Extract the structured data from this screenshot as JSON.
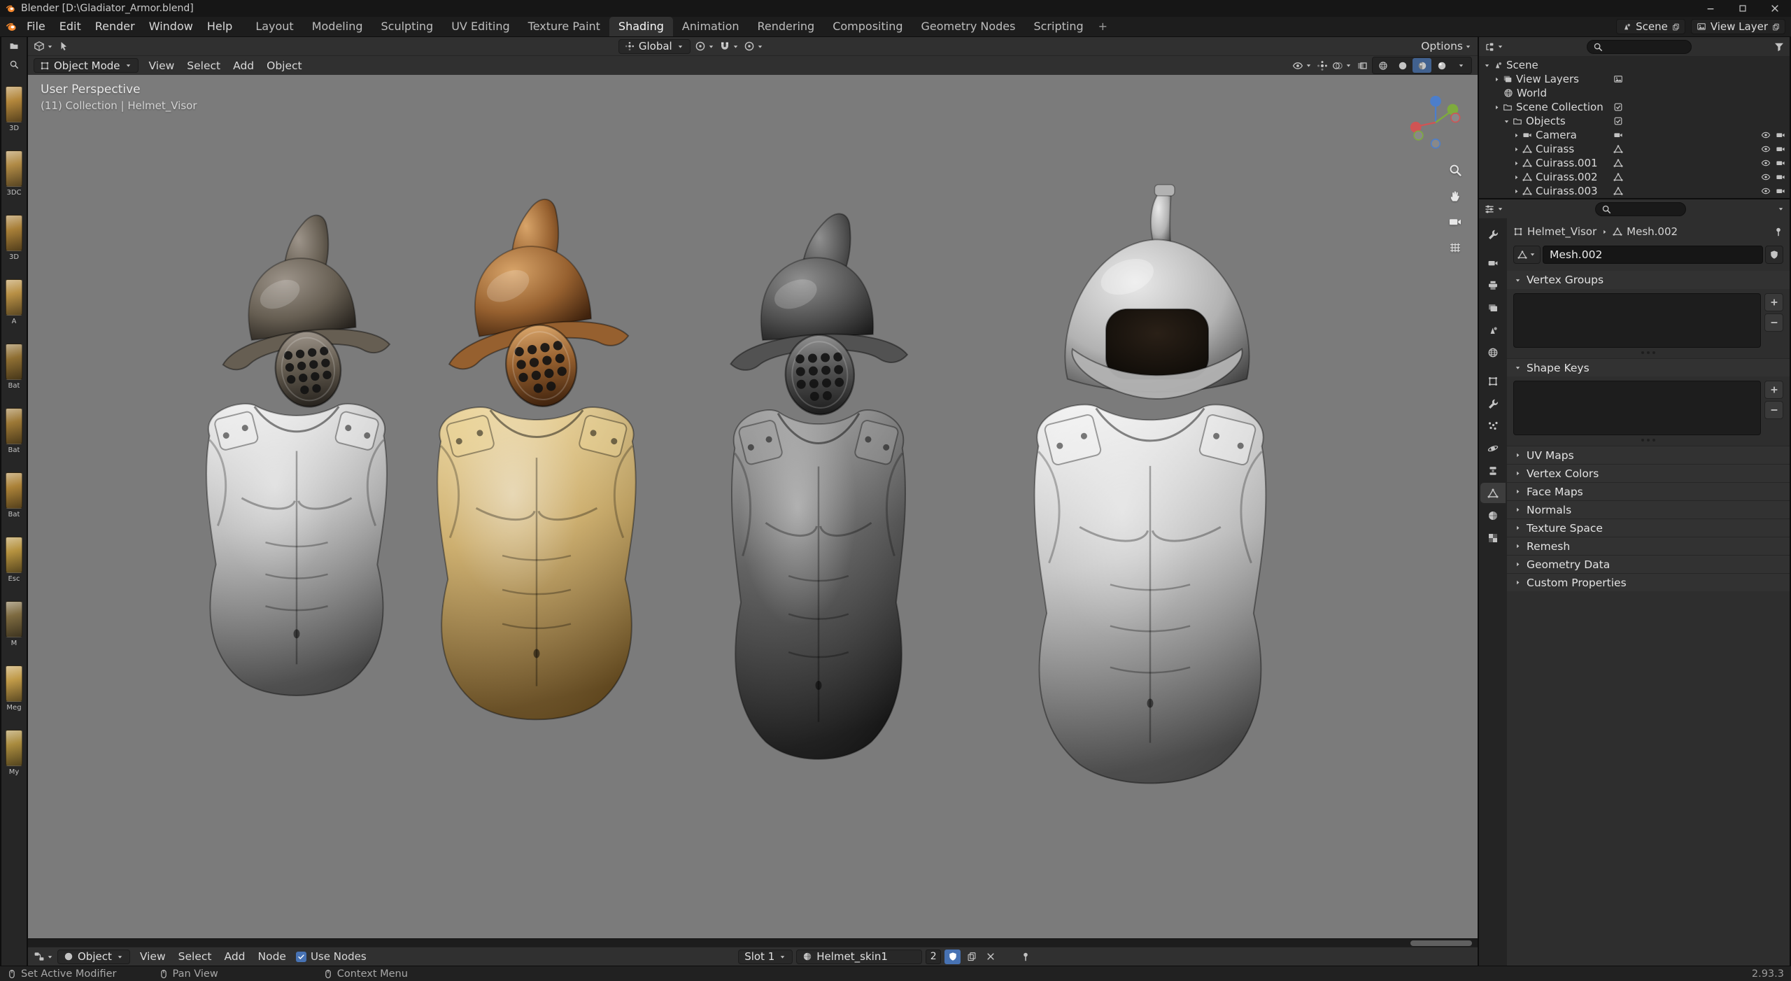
{
  "window": {
    "title": "Blender [D:\\Gladiator_Armor.blend]"
  },
  "topbar": {
    "menus": [
      "File",
      "Edit",
      "Render",
      "Window",
      "Help"
    ],
    "workspace_tabs": [
      "Layout",
      "Modeling",
      "Sculpting",
      "UV Editing",
      "Texture Paint",
      "Shading",
      "Animation",
      "Rendering",
      "Compositing",
      "Geometry Nodes",
      "Scripting"
    ],
    "active_tab": "Shading",
    "new_workspace_label": "+",
    "scene_selector": {
      "label": "Scene"
    },
    "view_layer_selector": {
      "label": "View Layer"
    }
  },
  "asset_strip": {
    "items": [
      {
        "label": "3D",
        "color": "#b3873c"
      },
      {
        "label": "3DC",
        "color": "#b08a45"
      },
      {
        "label": "3D",
        "color": "#a87f38"
      },
      {
        "label": "A",
        "color": "#b89045"
      },
      {
        "label": "Bat",
        "color": "#8f6f33"
      },
      {
        "label": "Bat",
        "color": "#9c7836"
      },
      {
        "label": "Bat",
        "color": "#ab8238"
      },
      {
        "label": "Esc",
        "color": "#b5923f"
      },
      {
        "label": "M",
        "color": "#7d6a40"
      },
      {
        "label": "Meg",
        "color": "#c09a48"
      },
      {
        "label": "My",
        "color": "#a98b3e"
      }
    ]
  },
  "viewport": {
    "tool_row": {
      "orientation": "Global",
      "options_label": "Options"
    },
    "header": {
      "mode": "Object Mode",
      "menus": [
        "View",
        "Select",
        "Add",
        "Object"
      ]
    },
    "overlay": {
      "line1": "User Perspective",
      "line2": "(11) Collection | Helmet_Visor"
    },
    "background_color": "#7b7b7b",
    "armor_sets": [
      {
        "name": "silver",
        "style": "closed",
        "torso": {
          "lite": "#f0f0f0",
          "base": "#b6b6b6",
          "dark": "#4f4f4f"
        },
        "helmet": {
          "lite": "#9d948a",
          "base": "#665e52",
          "dark": "#26221d"
        }
      },
      {
        "name": "bronze",
        "style": "closed",
        "torso": {
          "lite": "#ecd498",
          "base": "#c6a45c",
          "dark": "#6e501f"
        },
        "helmet": {
          "lite": "#d8a469",
          "base": "#96602f",
          "dark": "#3f220d"
        }
      },
      {
        "name": "dark-steel",
        "style": "closed",
        "torso": {
          "lite": "#9d9d9d",
          "base": "#4e4e4e",
          "dark": "#161616"
        },
        "helmet": {
          "lite": "#8f8f8f",
          "base": "#525252",
          "dark": "#1c1c1c"
        }
      },
      {
        "name": "polished-steel",
        "style": "open",
        "torso": {
          "lite": "#f4f4f4",
          "base": "#bfbfbf",
          "dark": "#4c4c4c"
        },
        "helmet": {
          "lite": "#e9e9e9",
          "base": "#b2b2b2",
          "dark": "#383838"
        }
      }
    ]
  },
  "outliner": {
    "rows": [
      {
        "label": "Scene",
        "depth": 0,
        "disclosure": "open",
        "icon": "scene"
      },
      {
        "label": "View Layers",
        "depth": 1,
        "disclosure": "closed",
        "icon": "layers",
        "data_icon": "photo"
      },
      {
        "label": "World",
        "depth": 1,
        "disclosure": "none",
        "icon": "globe"
      },
      {
        "label": "Scene Collection",
        "depth": 1,
        "disclosure": "closed",
        "icon": "collection",
        "data_icon": "check"
      },
      {
        "label": "Objects",
        "depth": 2,
        "disclosure": "open",
        "icon": "collection",
        "data_icon": "check"
      },
      {
        "label": "Camera",
        "depth": 3,
        "disclosure": "closed",
        "icon": "cam",
        "data_icon": "cam",
        "data_color": "green",
        "toggles": true
      },
      {
        "label": "Cuirass",
        "depth": 3,
        "disclosure": "closed",
        "icon": "tri",
        "data_icon": "tri",
        "data_color": "green",
        "toggles": true
      },
      {
        "label": "Cuirass.001",
        "depth": 3,
        "disclosure": "closed",
        "icon": "tri",
        "data_icon": "tri",
        "data_color": "green",
        "toggles": true
      },
      {
        "label": "Cuirass.002",
        "depth": 3,
        "disclosure": "closed",
        "icon": "tri",
        "data_icon": "tri",
        "data_color": "green",
        "toggles": true
      },
      {
        "label": "Cuirass.003",
        "depth": 3,
        "disclosure": "closed",
        "icon": "tri",
        "data_icon": "tri",
        "data_color": "green",
        "toggles": true
      }
    ]
  },
  "properties": {
    "breadcrumb": {
      "object": "Helmet_Visor",
      "data": "Mesh.002"
    },
    "datablock_name": "Mesh.002",
    "panels": [
      {
        "label": "Vertex Groups",
        "open": true
      },
      {
        "label": "Shape Keys",
        "open": true
      },
      {
        "label": "UV Maps",
        "open": false
      },
      {
        "label": "Vertex Colors",
        "open": false
      },
      {
        "label": "Face Maps",
        "open": false
      },
      {
        "label": "Normals",
        "open": false
      },
      {
        "label": "Texture Space",
        "open": false
      },
      {
        "label": "Remesh",
        "open": false
      },
      {
        "label": "Geometry Data",
        "open": false
      },
      {
        "label": "Custom Properties",
        "open": false
      }
    ]
  },
  "shader_editor": {
    "type_label": "Object",
    "menus": [
      "View",
      "Select",
      "Add",
      "Node"
    ],
    "use_nodes_label": "Use Nodes",
    "slot_label": "Slot 1",
    "material_name": "Helmet_skin1",
    "users_count": "2"
  },
  "statusbar": {
    "items": [
      "Set Active Modifier",
      "Pan View",
      "Context Menu"
    ],
    "version": "2.93.3"
  }
}
